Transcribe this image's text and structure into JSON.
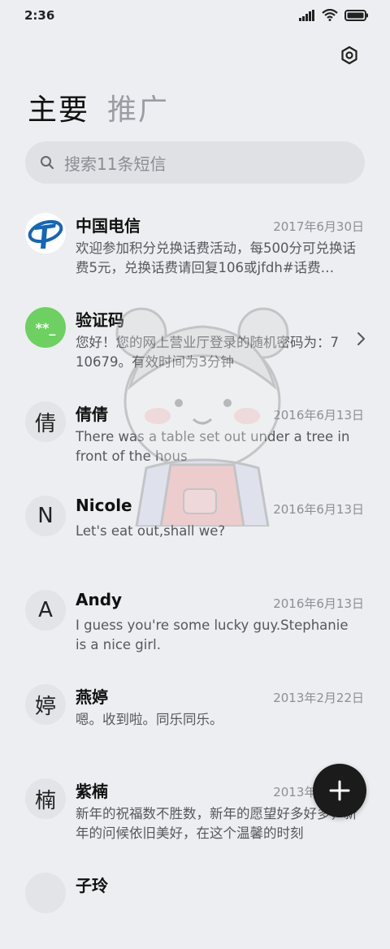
{
  "status": {
    "time": "2:36"
  },
  "tabs": [
    {
      "label": "主要"
    },
    {
      "label": "推广"
    }
  ],
  "search": {
    "placeholder": "搜索11条短信"
  },
  "messages": [
    {
      "sender": "中国电信",
      "date": "2017年6月30日",
      "preview": "欢迎参加积分兑换话费活动，每500分可兑换话费5元，兑换话费请回复106或jfdh#话费…",
      "avatar": "",
      "avatar_type": "telecom-logo"
    },
    {
      "sender": "验证码",
      "date": "",
      "preview": "您好！您的网上营业厅登录的随机密码为：710679。有效时间为3分钟",
      "avatar": "**_",
      "avatar_type": "code"
    },
    {
      "sender": "倩倩",
      "date": "2016年6月13日",
      "preview": "There was a table set out under a tree in front of the hous",
      "avatar": "倩",
      "avatar_type": "letter"
    },
    {
      "sender": "Nicole",
      "date": "2016年6月13日",
      "preview": "Let's eat out,shall we?",
      "avatar": "N",
      "avatar_type": "letter"
    },
    {
      "sender": "Andy",
      "date": "2016年6月13日",
      "preview": "I guess you're some lucky guy.Stephanie is a nice girl.",
      "avatar": "A",
      "avatar_type": "letter"
    },
    {
      "sender": "燕婷",
      "date": "2013年2月22日",
      "preview": "嗯。收到啦。同乐同乐。",
      "avatar": "婷",
      "avatar_type": "letter"
    },
    {
      "sender": "紫楠",
      "date": "2013年2月22日",
      "preview": "新年的祝福数不胜数，新年的愿望好多好多，新年的问候依旧美好，在这个温馨的时刻",
      "avatar": "楠",
      "avatar_type": "letter"
    },
    {
      "sender": "子玲",
      "date": "",
      "preview": "",
      "avatar": "",
      "avatar_type": "letter"
    }
  ],
  "colors": {
    "code_avatar": "#6cd160",
    "telecom_blue": "#1466b8",
    "fab": "#1b1b1b"
  },
  "icons": {
    "settings": "settings-icon",
    "search": "search-icon",
    "compose": "plus-icon",
    "chevron": "chevron-right-icon"
  }
}
